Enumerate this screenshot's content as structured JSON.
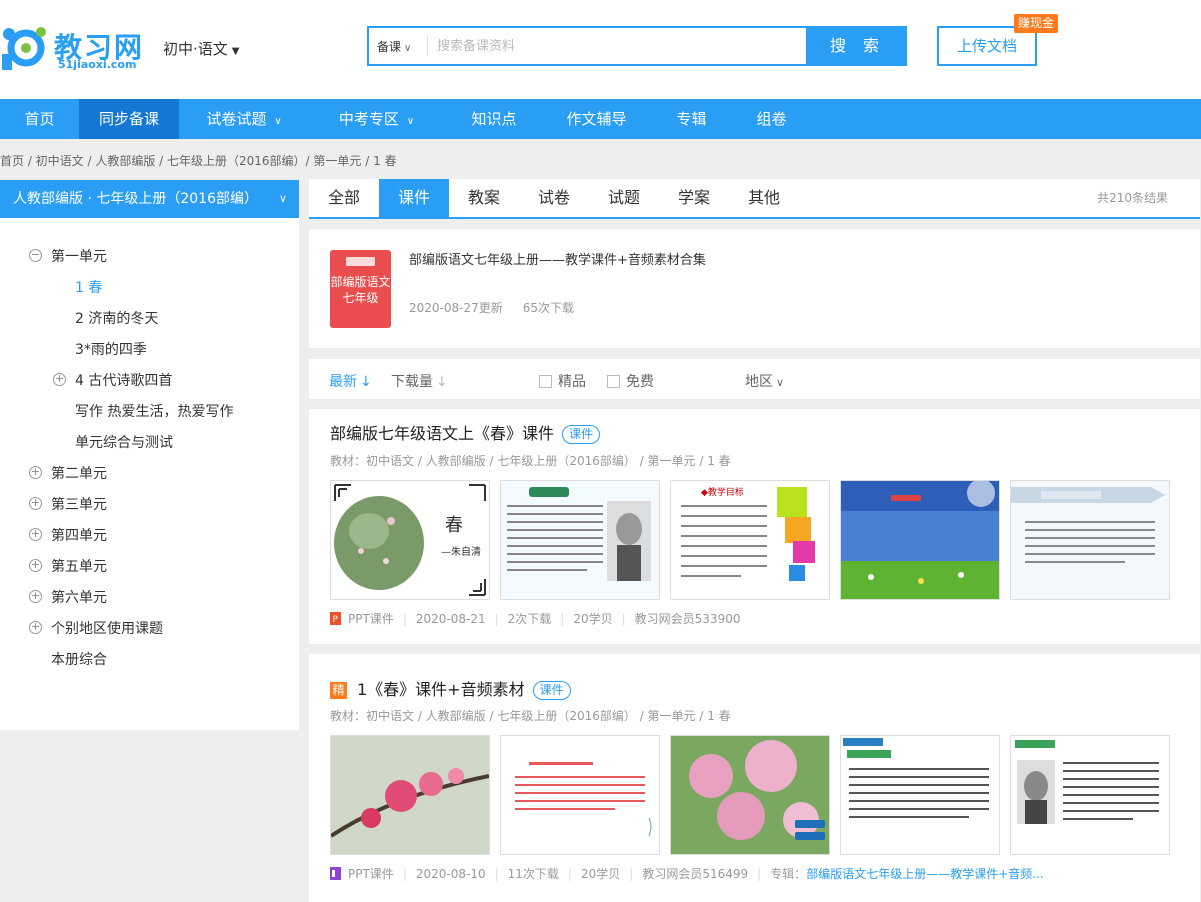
{
  "header": {
    "logo_text": "教习网",
    "logo_sub": "51jiaoxi.com",
    "subject": "初中·语文",
    "search_type": "备课",
    "search_placeholder": "搜索备课资料",
    "search_button": "搜 索",
    "upload_button": "上传文档",
    "earn_badge": "赚现金"
  },
  "nav": {
    "items": [
      {
        "label": "首页"
      },
      {
        "label": "同步备课"
      },
      {
        "label": "试卷试题"
      },
      {
        "label": "中考专区"
      },
      {
        "label": "知识点"
      },
      {
        "label": "作文辅导"
      },
      {
        "label": "专辑"
      },
      {
        "label": "组卷"
      }
    ]
  },
  "breadcrumb": "首页 / 初中语文 / 人教部编版 / 七年级上册（2016部编）/ 第一单元 / 1 春",
  "sidebar": {
    "header": "人教部编版 · 七年级上册（2016部编）",
    "items": [
      {
        "label": "第一单元"
      },
      {
        "label": "1 春"
      },
      {
        "label": "2 济南的冬天"
      },
      {
        "label": "3*雨的四季"
      },
      {
        "label": "4 古代诗歌四首"
      },
      {
        "label": "写作 热爱生活，热爱写作"
      },
      {
        "label": "单元综合与测试"
      },
      {
        "label": "第二单元"
      },
      {
        "label": "第三单元"
      },
      {
        "label": "第四单元"
      },
      {
        "label": "第五单元"
      },
      {
        "label": "第六单元"
      },
      {
        "label": "个别地区使用课题"
      },
      {
        "label": "本册综合"
      }
    ],
    "expand_symbols": {
      "minus": "⊖",
      "plus": "⊕"
    }
  },
  "tabs": {
    "items": [
      {
        "label": "全部"
      },
      {
        "label": "课件"
      },
      {
        "label": "教案"
      },
      {
        "label": "试卷"
      },
      {
        "label": "试题"
      },
      {
        "label": "学案"
      },
      {
        "label": "其他"
      }
    ],
    "total": "共210条结果"
  },
  "album": {
    "cover_text": "部编版语文七年级",
    "title": "部编版语文七年级上册——教学课件+音频素材合集",
    "date": "2020-08-27更新",
    "downloads": "65次下载"
  },
  "filters": {
    "latest": "最新",
    "downloads": "下载量",
    "premium": "精品",
    "free": "免费",
    "region": "地区"
  },
  "results": [
    {
      "title": "部编版七年级语文上《春》课件",
      "tag": "课件",
      "path": "教材：初中语文 / 人教部编版 / 七年级上册（2016部编） / 第一单元 / 1 春",
      "type": "PPT课件",
      "date": "2020-08-21",
      "downloads": "2次下载",
      "points": "20学贝",
      "author": "教习网会员533900",
      "thumb1_title": "春",
      "thumb1_author": "—朱自清"
    },
    {
      "premium_mark": "精",
      "title": "1《春》课件+音频素材",
      "tag": "课件",
      "path": "教材：初中语文 / 人教部编版 / 七年级上册（2016部编） / 第一单元 / 1 春",
      "type": "PPT课件",
      "date": "2020-08-10",
      "downloads": "11次下载",
      "points": "20学贝",
      "author": "教习网会员516499",
      "album_label": "专辑：",
      "album_link": "部编版语文七年级上册——教学课件+音频..."
    }
  ],
  "colors": {
    "brand": "#2a9df4",
    "nav_active": "#1477d3",
    "badge": "#ff7a1a",
    "cover": "#ea4d4d"
  }
}
